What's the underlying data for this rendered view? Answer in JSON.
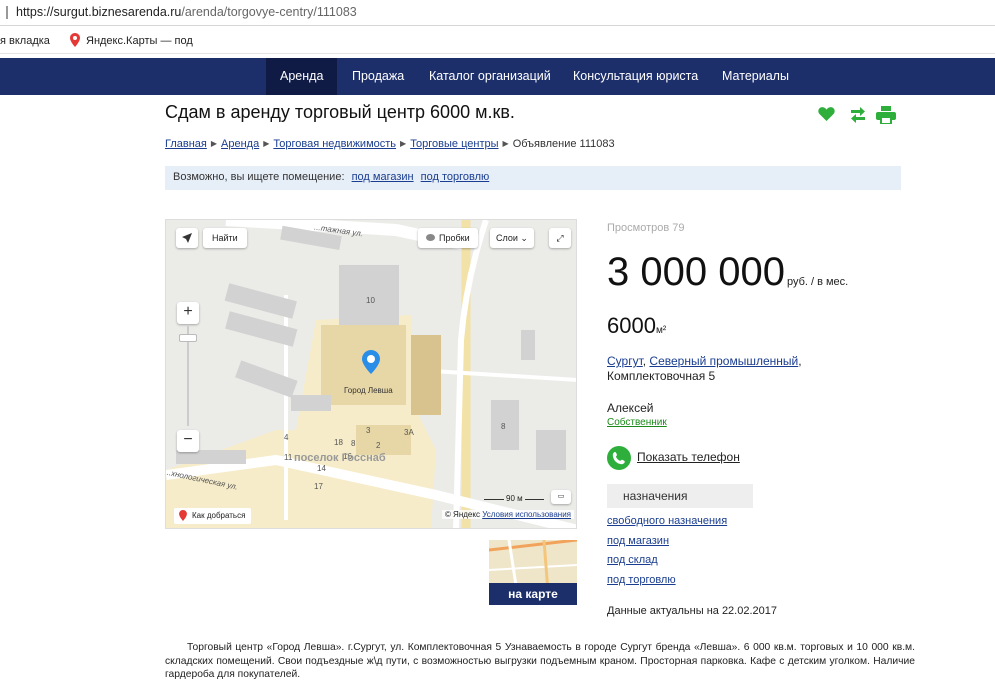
{
  "browser": {
    "url_host": "https://surgut.biznesarenda.ru",
    "url_path": "/arenda/torgovye-centry/111083",
    "bookmarks": [
      "я вкладка",
      "Яндекс.Карты — под"
    ]
  },
  "nav": [
    "Аренда",
    "Продажа",
    "Каталог организаций",
    "Консультация юриста",
    "Материалы"
  ],
  "title": "Сдам в аренду торговый центр 6000 м.кв.",
  "breadcrumb": {
    "links": [
      "Главная",
      "Аренда",
      "Торговая недвижимость",
      "Торговые центры"
    ],
    "current": "Объявление 111083"
  },
  "hint": {
    "text": "Возможно, вы ищете помещение:",
    "links": [
      "под магазин",
      "под торговлю"
    ]
  },
  "map": {
    "find": "Найти",
    "traffic": "Пробки",
    "layers": "Слои",
    "place_label": "Город Левша",
    "district_label": "поселок Госснаб",
    "street_top": "...тажная ул.",
    "street_left": "...хнологическая ул.",
    "house_numbers": [
      "10",
      "4",
      "18",
      "8",
      "2",
      "3",
      "3А",
      "8",
      "11",
      "16",
      "14",
      "17"
    ],
    "scale": "90 м",
    "howto": "Как добраться",
    "copyright_prefix": "© Яндекс",
    "copyright_link": "Условия использования",
    "mini_button": "на карте"
  },
  "listing": {
    "views": "Просмотров 79",
    "price": "3 000 000",
    "price_unit": "руб. / в мес.",
    "area": "6000",
    "area_unit": "м²",
    "city": "Сургут",
    "district": "Северный промышленный",
    "street": "Комплектовочная 5",
    "owner_name": "Алексей",
    "owner_type": "Собственник",
    "phone_button": "Показать телефон",
    "purpose_title": "назначения",
    "purposes": [
      "свободного назначения",
      "под магазин",
      "под склад",
      "под торговлю"
    ],
    "updated": "Данные актуальны на 22.02.2017"
  },
  "description": "Торговый центр «Город Левша». г.Сургут, ул. Комплектовочная 5 Узнаваемость в городе Сургут бренда «Левша». 6 000 кв.м. торговых и 10 000 кв.м. складских помещений. Свои подъездные ж\\д пути, с возможностью выгрузки подъемным краном. Просторная парковка. Кафе с детским уголком. Наличие гардероба для покупателей.",
  "colors": {
    "nav_bg": "#1d2f6b",
    "accent_green": "#2eaf3c",
    "link": "#1a3d8f"
  }
}
